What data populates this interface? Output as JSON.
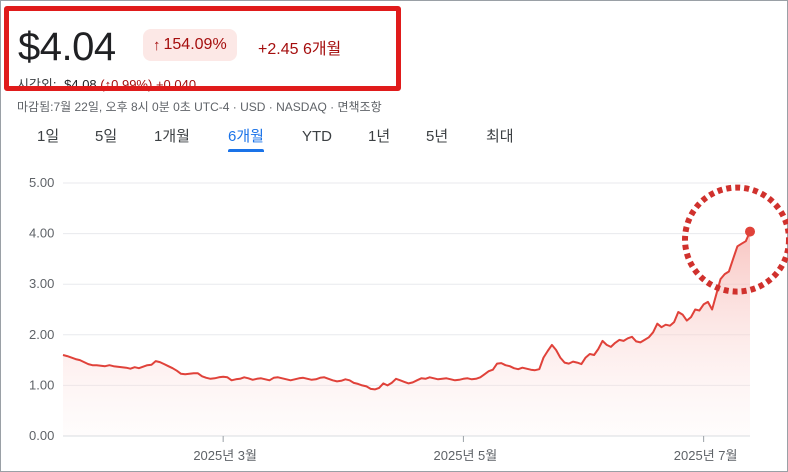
{
  "quote": {
    "price": "$4.04",
    "change_arrow": "↑",
    "change_pct": "154.09%",
    "change_abs": "+2.45",
    "range_label": "6개월"
  },
  "after_hours": {
    "label": "시간외:",
    "price": "$4.08",
    "pct_text": "(↑0.99%)",
    "abs": "+0.040"
  },
  "disclaimer": "마감됨:7월 22일, 오후 8시 0분 0초 UTC-4 · USD · NASDAQ · 면책조항",
  "range_tabs": [
    {
      "label": "1일",
      "active": false
    },
    {
      "label": "5일",
      "active": false
    },
    {
      "label": "1개월",
      "active": false
    },
    {
      "label": "6개월",
      "active": true
    },
    {
      "label": "YTD",
      "active": false
    },
    {
      "label": "1년",
      "active": false
    },
    {
      "label": "5년",
      "active": false
    },
    {
      "label": "최대",
      "active": false
    }
  ],
  "colors": {
    "line": "#e0423a",
    "area_top": "#f6b3ae",
    "highlight": "#e01b1b",
    "negative_text": "#a50e0e",
    "active_tab": "#1a73e8"
  },
  "chart_data": {
    "type": "area",
    "ylim": [
      0,
      5
    ],
    "yticks": [
      "0.00",
      "1.00",
      "2.00",
      "3.00",
      "4.00",
      "5.00"
    ],
    "xtick_labels": [
      "2025년 3월",
      "2025년 5월",
      "2025년 7월"
    ],
    "grid": true,
    "x_unit": "trading day index (0 = start of 6-month range)",
    "values": [
      1.6,
      1.58,
      1.55,
      1.52,
      1.5,
      1.46,
      1.42,
      1.4,
      1.4,
      1.39,
      1.38,
      1.4,
      1.38,
      1.37,
      1.36,
      1.35,
      1.33,
      1.36,
      1.34,
      1.37,
      1.4,
      1.41,
      1.48,
      1.46,
      1.42,
      1.38,
      1.34,
      1.29,
      1.23,
      1.22,
      1.23,
      1.24,
      1.24,
      1.18,
      1.15,
      1.13,
      1.14,
      1.16,
      1.17,
      1.16,
      1.1,
      1.12,
      1.13,
      1.16,
      1.14,
      1.11,
      1.13,
      1.14,
      1.12,
      1.1,
      1.15,
      1.16,
      1.14,
      1.12,
      1.1,
      1.12,
      1.14,
      1.15,
      1.13,
      1.11,
      1.12,
      1.15,
      1.16,
      1.13,
      1.1,
      1.08,
      1.09,
      1.12,
      1.1,
      1.05,
      1.03,
      1.0,
      0.98,
      0.93,
      0.92,
      0.95,
      1.04,
      1.0,
      1.05,
      1.13,
      1.1,
      1.07,
      1.04,
      1.06,
      1.1,
      1.14,
      1.13,
      1.16,
      1.14,
      1.12,
      1.13,
      1.14,
      1.12,
      1.1,
      1.11,
      1.13,
      1.14,
      1.12,
      1.13,
      1.16,
      1.22,
      1.28,
      1.31,
      1.43,
      1.44,
      1.4,
      1.38,
      1.34,
      1.32,
      1.35,
      1.33,
      1.31,
      1.3,
      1.32,
      1.55,
      1.68,
      1.8,
      1.7,
      1.55,
      1.45,
      1.43,
      1.47,
      1.45,
      1.42,
      1.55,
      1.62,
      1.6,
      1.72,
      1.88,
      1.8,
      1.76,
      1.84,
      1.9,
      1.88,
      1.93,
      1.96,
      1.87,
      1.85,
      1.9,
      1.95,
      2.05,
      2.22,
      2.15,
      2.2,
      2.18,
      2.25,
      2.45,
      2.4,
      2.28,
      2.35,
      2.5,
      2.48,
      2.6,
      2.65,
      2.5,
      2.8,
      3.1,
      3.2,
      3.25,
      3.5,
      3.75,
      3.8,
      3.85,
      4.04
    ]
  }
}
